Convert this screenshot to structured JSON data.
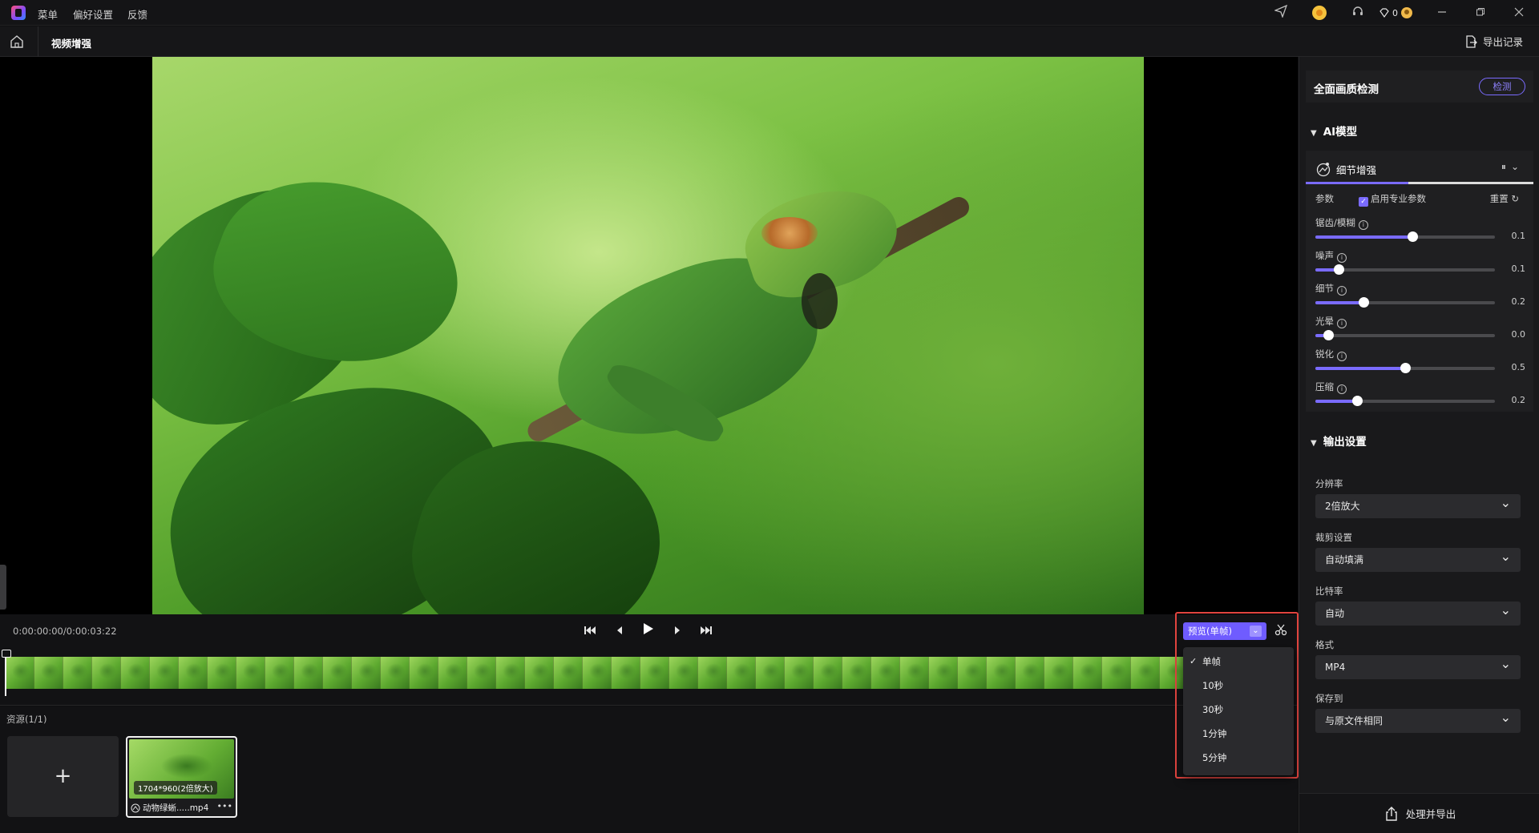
{
  "titlebar": {
    "menus": [
      "菜单",
      "偏好设置",
      "反馈"
    ],
    "credit_count": "0",
    "icons": [
      "send-icon",
      "avatar-icon",
      "headset-icon",
      "diamond-icon",
      "minimize-icon",
      "restore-icon",
      "close-icon"
    ]
  },
  "tabbar": {
    "title": "视频增强",
    "export_records": "导出记录"
  },
  "playback": {
    "timecode": "0:00:00:00/0:00:03:22"
  },
  "resources": {
    "title": "资源(1/1)",
    "add_label": "+",
    "clip": {
      "resolution_badge": "1704*960(2倍放大)",
      "name": "动物绿蜥.....mp4",
      "more": "•••"
    }
  },
  "preview_dropdown": {
    "button_label": "预览(单帧)",
    "options": [
      {
        "label": "单帧",
        "selected": true
      },
      {
        "label": "10秒",
        "selected": false
      },
      {
        "label": "30秒",
        "selected": false
      },
      {
        "label": "1分钟",
        "selected": false
      },
      {
        "label": "5分钟",
        "selected": false
      }
    ]
  },
  "panel": {
    "quality_check": {
      "title": "全面画质检测",
      "button": "检测"
    },
    "ai_model": {
      "section_title": "AI模型",
      "model_name": "细节增强",
      "params_label": "参数",
      "pro_params_label": "启用专业参数",
      "pro_params_checked": true,
      "reset_label": "重置",
      "sliders": [
        {
          "label": "锯齿/模糊",
          "value": "0.1",
          "level": 0.54
        },
        {
          "label": "噪声",
          "value": "0.1",
          "level": 0.13
        },
        {
          "label": "细节",
          "value": "0.2",
          "level": 0.27
        },
        {
          "label": "光晕",
          "value": "0.0",
          "level": 0.07
        },
        {
          "label": "锐化",
          "value": "0.5",
          "level": 0.5
        },
        {
          "label": "压缩",
          "value": "0.2",
          "level": 0.23
        }
      ]
    },
    "output": {
      "section_title": "输出设置",
      "fields": [
        {
          "label": "分辨率",
          "value": "2倍放大"
        },
        {
          "label": "裁剪设置",
          "value": "自动填满"
        },
        {
          "label": "比特率",
          "value": "自动"
        },
        {
          "label": "格式",
          "value": "MP4"
        },
        {
          "label": "保存到",
          "value": "与原文件相同"
        }
      ]
    },
    "export_button": "处理并导出"
  },
  "colors": {
    "accent": "#7a6bff",
    "highlight_border": "#e1443f",
    "background": "#0f0f10"
  }
}
